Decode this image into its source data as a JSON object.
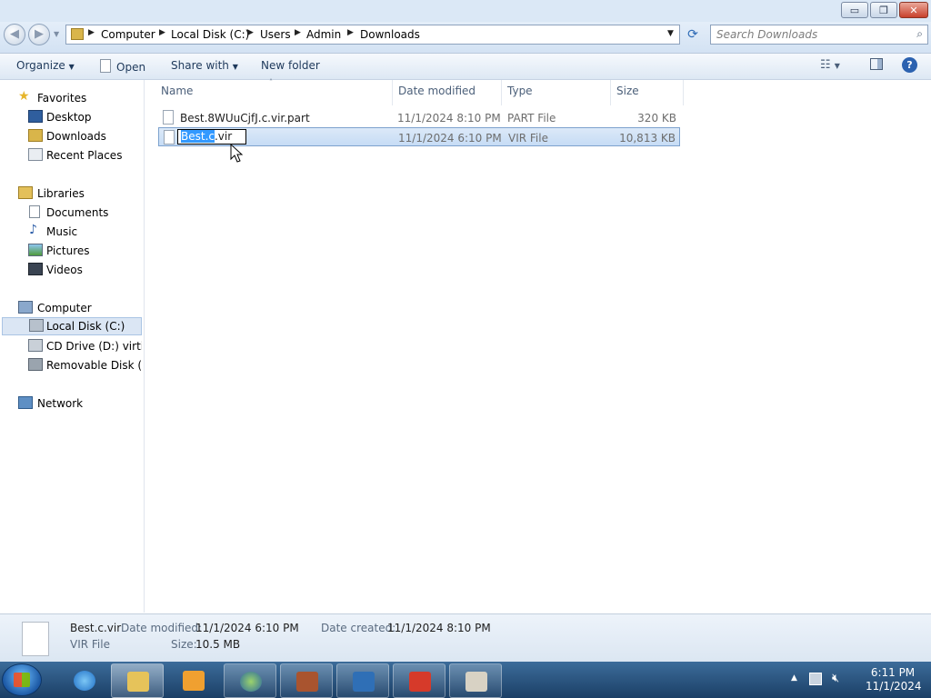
{
  "window": {
    "minimize_label": "▭",
    "maximize_label": "❐",
    "close_label": "✕"
  },
  "nav": {
    "back_icon": "back-arrow-icon",
    "forward_icon": "forward-arrow-icon",
    "breadcrumb": [
      "Computer",
      "Local Disk (C:)",
      "Users",
      "Admin",
      "Downloads"
    ],
    "search_placeholder": "Search Downloads"
  },
  "toolbar": {
    "organize": "Organize",
    "open": "Open",
    "share_with": "Share with",
    "new_folder": "New folder"
  },
  "sidebar": {
    "favorites": "Favorites",
    "favorites_items": [
      "Desktop",
      "Downloads",
      "Recent Places"
    ],
    "libraries": "Libraries",
    "libraries_items": [
      "Documents",
      "Music",
      "Pictures",
      "Videos"
    ],
    "computer": "Computer",
    "computer_items": [
      "Local Disk (C:)",
      "CD Drive (D:) virtio-w",
      "Removable Disk (E:)"
    ],
    "network": "Network"
  },
  "columns": {
    "name": "Name",
    "date_modified": "Date modified",
    "type": "Type",
    "size": "Size"
  },
  "files": [
    {
      "name": "Best.8WUuCjfJ.c.vir.part",
      "date": "11/1/2024 8:10 PM",
      "type": "PART File",
      "size": "320 KB"
    },
    {
      "name": "Best.c.vir",
      "date": "11/1/2024 6:10 PM",
      "type": "VIR File",
      "size": "10,813 KB",
      "rename_selected": "Best.c",
      "rename_rest": ".vir"
    }
  ],
  "details": {
    "filename": "Best.c.vir",
    "filetype": "VIR File",
    "date_modified_label": "Date modified:",
    "date_modified": "11/1/2024 6:10 PM",
    "date_created_label": "Date created:",
    "date_created": "11/1/2024 8:10 PM",
    "size_label": "Size:",
    "size": "10.5 MB"
  },
  "taskbar": {
    "time": "6:11 PM",
    "date": "11/1/2024"
  }
}
